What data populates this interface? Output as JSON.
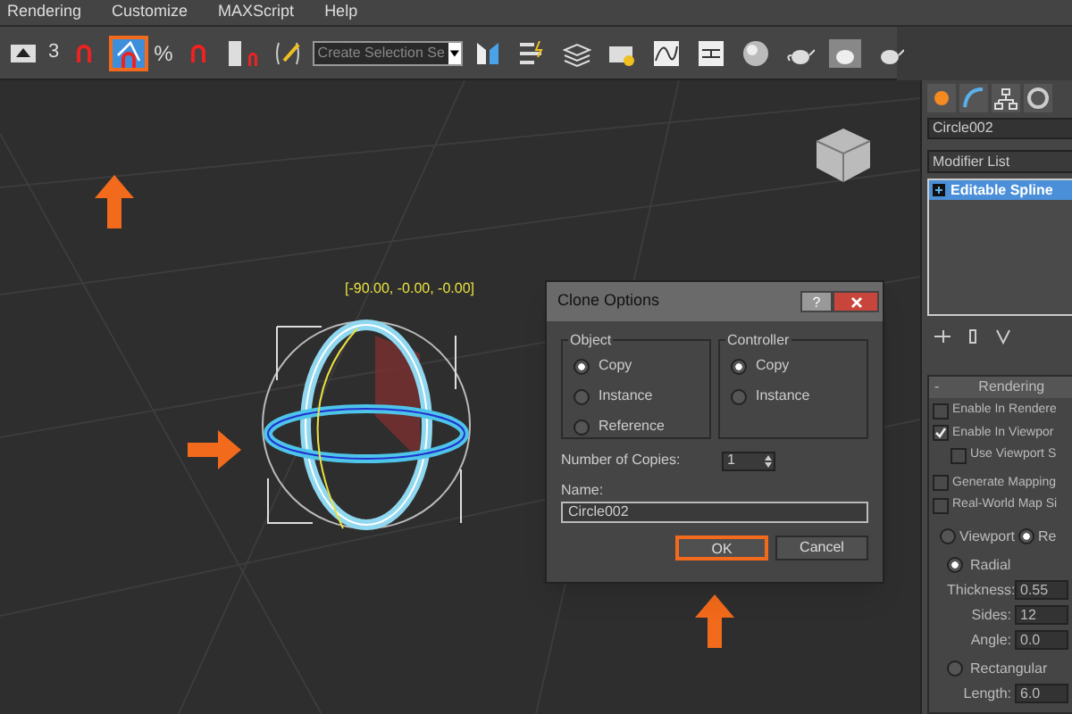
{
  "menu": [
    "Rendering",
    "Customize",
    "MAXScript",
    "Help"
  ],
  "toolbar": {
    "snap_label": "3",
    "percent_label": "%",
    "angle_snap_selected": true,
    "selection_set": "Create Selection Se"
  },
  "viewport": {
    "rotation_readout": "[-90.00, -0.00, -0.00]"
  },
  "dialog": {
    "title": "Clone Options",
    "help": "?",
    "object": {
      "title": "Object",
      "options": [
        {
          "label": "Copy",
          "selected": true
        },
        {
          "label": "Instance",
          "selected": false
        },
        {
          "label": "Reference",
          "selected": false
        }
      ]
    },
    "controller": {
      "title": "Controller",
      "options": [
        {
          "label": "Copy",
          "selected": true
        },
        {
          "label": "Instance",
          "selected": false
        }
      ]
    },
    "copies_label": "Number of Copies:",
    "copies_value": "1",
    "name_label": "Name:",
    "name_value": "Circle002",
    "buttons": [
      {
        "label": "OK",
        "focused": true
      },
      {
        "label": "Cancel",
        "focused": false
      }
    ]
  },
  "panel": {
    "object_name": "Circle002",
    "modifier_list": "Modifier List",
    "stack": [
      {
        "label": "Editable Spline",
        "selected": true
      }
    ],
    "rollout": {
      "toggle": "-",
      "title": "Rendering"
    },
    "checks": [
      {
        "label": "Enable In Rendere",
        "checked": false
      },
      {
        "label": "Enable In Viewpor",
        "checked": true,
        "children": [
          {
            "label": "Use Viewport S",
            "checked": false
          }
        ]
      },
      {
        "label": "Generate Mapping",
        "checked": false
      },
      {
        "label": "Real-World Map Si",
        "checked": false
      }
    ],
    "mode": [
      {
        "label": "Viewport",
        "selected": false
      },
      {
        "label": "Re",
        "selected": true
      }
    ],
    "radial": {
      "label": "Radial",
      "selected": true,
      "fields": [
        {
          "label": "Thickness:",
          "value": "0.55"
        },
        {
          "label": "Sides:",
          "value": "12"
        },
        {
          "label": "Angle:",
          "value": "0.0"
        }
      ]
    },
    "rectangular": {
      "label": "Rectangular",
      "selected": false,
      "fields": [
        {
          "label": "Length:",
          "value": "6.0"
        }
      ]
    }
  }
}
